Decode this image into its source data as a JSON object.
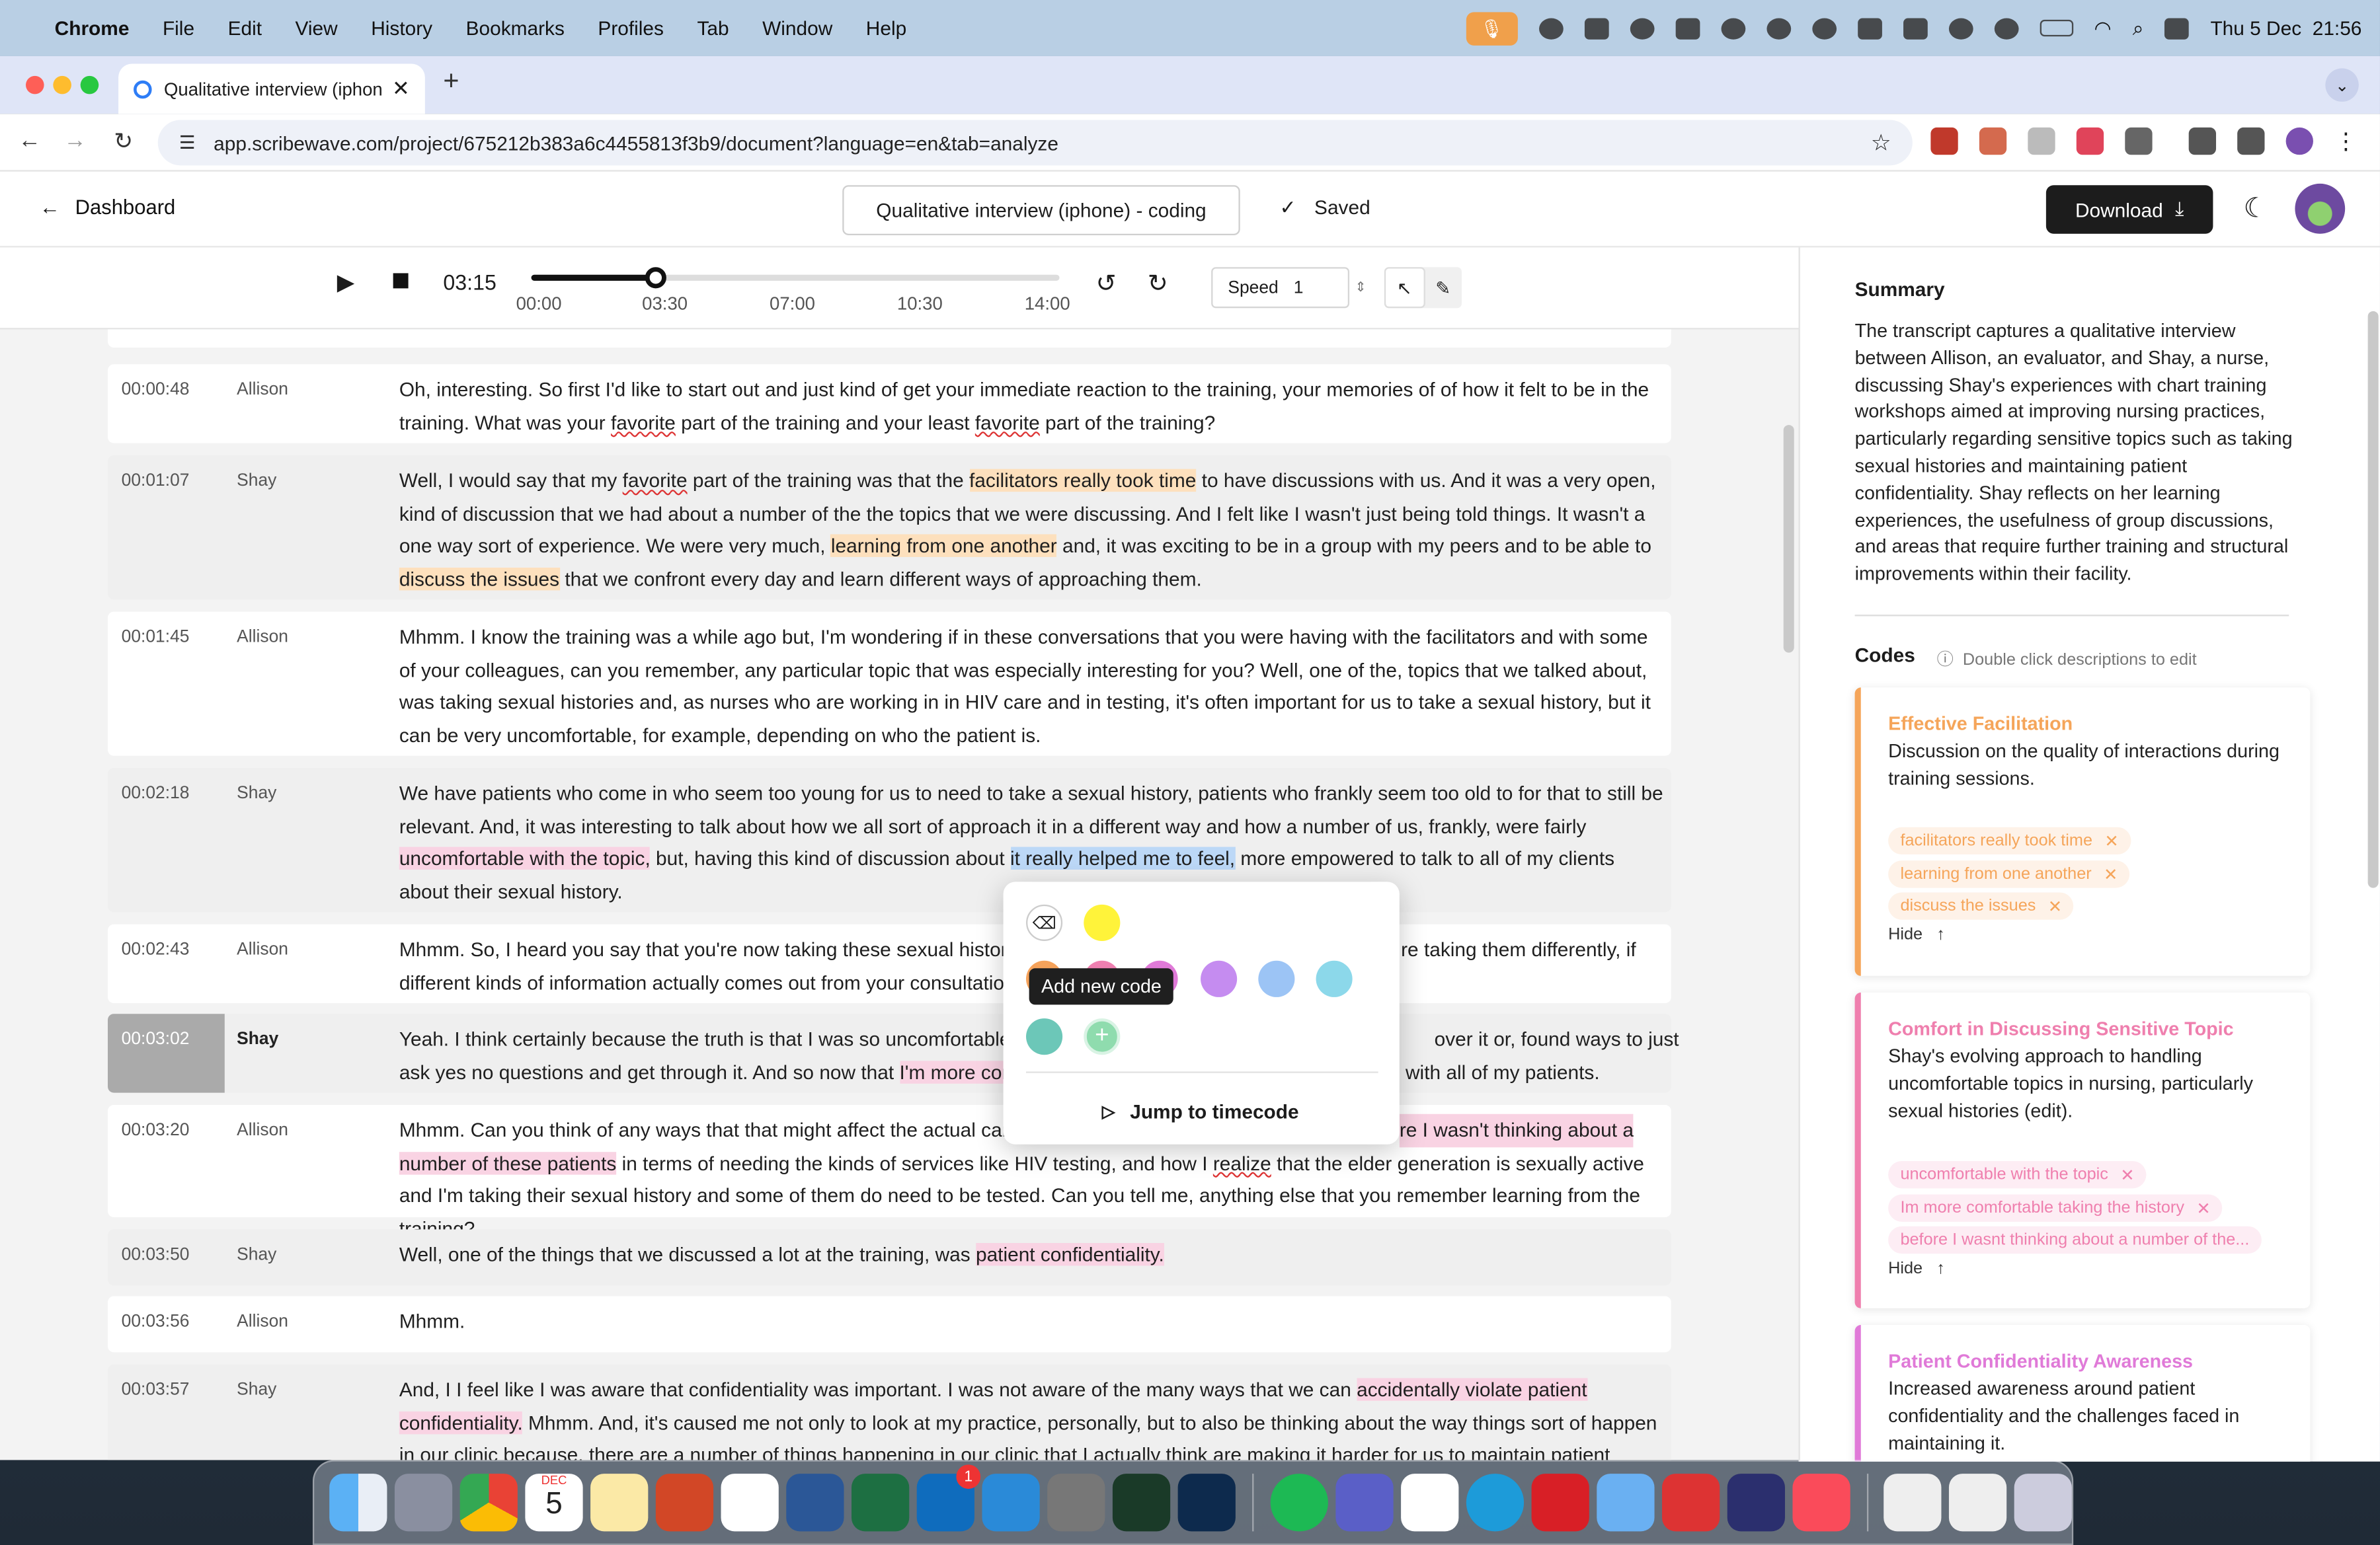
{
  "menubar": {
    "app": "Chrome",
    "items": [
      "File",
      "Edit",
      "View",
      "History",
      "Bookmarks",
      "Profiles",
      "Tab",
      "Window",
      "Help"
    ],
    "clock": "Thu 5 Dec  21:56"
  },
  "browser": {
    "tab_title": "Qualitative interview (iphone)",
    "url": "app.scribewave.com/project/675212b383a6c4455813f3b9/document?language=en&tab=analyze"
  },
  "header": {
    "back_label": "Dashboard",
    "doc_title": "Qualitative interview (iphone) - coding",
    "saved_label": "Saved",
    "download_label": "Download"
  },
  "player": {
    "current_time": "03:15",
    "progress_fraction": 0.235,
    "ticks": [
      "00:00",
      "03:30",
      "07:00",
      "10:30",
      "14:00"
    ],
    "speed_label": "Speed",
    "speed_value": "1"
  },
  "segments": [
    {
      "time": "00:00:48",
      "speaker": "Allison"
    },
    {
      "time": "00:01:07",
      "speaker": "Shay"
    },
    {
      "time": "00:01:45",
      "speaker": "Allison"
    },
    {
      "time": "00:02:18",
      "speaker": "Shay"
    },
    {
      "time": "00:02:43",
      "speaker": "Allison"
    },
    {
      "time": "00:03:02",
      "speaker": "Shay"
    },
    {
      "time": "00:03:20",
      "speaker": "Allison"
    },
    {
      "time": "00:03:50",
      "speaker": "Shay"
    },
    {
      "time": "00:03:56",
      "speaker": "Allison"
    },
    {
      "time": "00:03:57",
      "speaker": "Shay"
    }
  ],
  "text": {
    "s0a": "Oh, interesting. So first I'd like to start out and just kind of get your immediate reaction to the training, your memories of of how it felt to be in the training. What was your ",
    "s0b": "favorite",
    "s0c": " part of the training and your least ",
    "s0d": "favorite",
    "s0e": " part of the training?",
    "s1a": "Well, I would say that my ",
    "s1b": "favorite",
    "s1c": " part of the training was that the ",
    "s1d": "facilitators really took time",
    "s1e": " to have discussions with us. And it was a very open, kind of discussion that we had about a number of the the topics that we were discussing. And I felt like I wasn't just being told things. It wasn't a one way sort of experience. We were very much, ",
    "s1f": "learning from one another",
    "s1g": " and, it was exciting to be in a group with my peers and to be able to ",
    "s1h": "discuss the issues",
    "s1i": " that we confront every day and learn different ways of approaching them.",
    "s2": "Mhmm. I know the training was a while ago but, I'm wondering if in these conversations that you were having with the facilitators and with some of your colleagues, can you remember, any particular topic that was especially interesting for you? Well, one of the, topics that we talked about, was taking sexual histories and, as nurses who are working in in HIV care and in testing, it's often important for us to take a sexual history, but it can be very uncomfortable, for example, depending on who the patient is.",
    "s3a": "We have patients who come in who seem too young for us to need to take a sexual history, patients who frankly seem too old to for that to still be relevant. And, it was interesting to talk about how we all sort of approach it in a different way and how a number of us, frankly, were fairly ",
    "s3b": "uncomfortable with the topic,",
    "s3c": " but, having this kind of discussion about ",
    "s3d": "it really helped me to feel,",
    "s3e": " more empowered to talk to all of my clients about their sexual history.",
    "s4a": "Mhmm. So, I heard you say that you're now taking these sexual histories",
    "s4b": "re taking them differently, if",
    "s4c": "different kinds of information actually comes out from your consultation",
    "s5a": "Yeah. I think certainly because the truth is that I was so uncomfortable",
    "s5b": "over it or, found ways to just",
    "s5c": "ask yes no questions and get through it. And so now that ",
    "s5d": "I'm more com",
    "s5e": "with all of my patients.",
    "s6a": "Mhmm. Can you think of any ways that that might affect the actual care",
    "s6b": "re I wasn't thinking about a",
    "s6c": "number of these patients",
    "s6d": " in terms of needing the kinds of services like HIV testing, and how I ",
    "s6e": "realize",
    "s6f": " that the elder generation is sexually active and I'm taking their sexual history and some of them do need to be tested. Can you tell me, anything else that you remember learning from the training?",
    "s7a": "Well, one of the things that we discussed a lot at the training, was ",
    "s7b": "patient confidentiality.",
    "s8": "Mhmm.",
    "s9a": "And, I I feel like I was aware that confidentiality was important. I was not aware of the many ways that we can ",
    "s9b": "accidentally violate patient confidentiality.",
    "s9c": " Mhmm. And, it's caused me not only to look at my practice, personally, but to also be thinking about the way things sort of happen in our clinic because, there are a number of things happening in our clinic that I actually think are making it harder for us to maintain patient"
  },
  "popup": {
    "tooltip": "Add new code",
    "add_symbol": "+",
    "jump_label": "Jump to timecode",
    "swatches": [
      "#fff33a",
      "#f5a25a",
      "#ee7fb0",
      "#e07ad8",
      "#c58cf0",
      "#9cc4f5",
      "#8cd8ea",
      "#6cc7b8"
    ]
  },
  "summary": {
    "heading": "Summary",
    "text": "The transcript captures a qualitative interview between Allison, an evaluator, and Shay, a nurse, discussing Shay's experiences with chart training workshops aimed at improving nursing practices, particularly regarding sensitive topics such as taking sexual histories and maintaining patient confidentiality. Shay reflects on her learning experiences, the usefulness of group discussions, and areas that require further training and structural improvements within their facility."
  },
  "codes": {
    "heading": "Codes",
    "hint": "Double click descriptions to edit",
    "hide_label": "Hide",
    "items": [
      {
        "name": "Effective Facilitation",
        "color": "#f5a55a",
        "desc": "Discussion on the quality of interactions during training sessions.",
        "chips": [
          "facilitators really took time",
          "learning from one another",
          "discuss the issues"
        ]
      },
      {
        "name": "Comfort in Discussing Sensitive Topic",
        "color": "#ef7fae",
        "desc": "Shay's evolving approach to handling uncomfortable topics in nursing, particularly sexual histories (edit).",
        "chips": [
          "uncomfortable with the topic",
          "Im more comfortable taking the history",
          "before I wasnt thinking about a number of the..."
        ]
      },
      {
        "name": "Patient Confidentiality Awareness",
        "color": "#e07ad8",
        "desc": "Increased awareness around patient confidentiality and the challenges faced in maintaining it.",
        "chips": []
      }
    ]
  },
  "dock": {
    "calendar_month": "DEC",
    "calendar_day": "5",
    "mail_badge": "1"
  }
}
